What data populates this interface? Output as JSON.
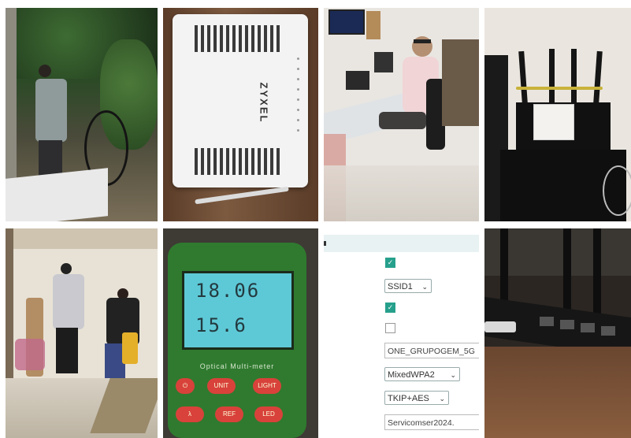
{
  "colors": {
    "background": "#ffffff",
    "checkbox_checked": "#26a08c",
    "meter_screen": "#5ec9d6",
    "meter_buttons": "#d8423a"
  },
  "photos": [
    {
      "icon": "technician-outdoor-photo"
    },
    {
      "icon": "router-photo",
      "brand": "ZYXEL"
    },
    {
      "icon": "technician-desk-photo"
    },
    {
      "icon": "wifi-router-antennas-photo"
    },
    {
      "icon": "installation-room-photo"
    },
    {
      "icon": "optical-meter-photo",
      "reading_top": "18.06",
      "reading_bottom": "15.6",
      "label": "Optical Multi-meter",
      "buttons": [
        "UNIT",
        "LIGHT",
        "λ",
        "REF",
        "LED"
      ]
    },
    {
      "icon": "wifi-settings-screenshot"
    },
    {
      "icon": "router-ports-photo"
    }
  ],
  "wifi_form": {
    "enable_checked": true,
    "ssid_select": "SSID1",
    "broadcast_checked": true,
    "isolation_checked": false,
    "ssid_name": "ONE_GRUPOGEM_5G",
    "auth_mode": "MixedWPA2",
    "encryption": "TKIP+AES",
    "password": "Servicomser2024."
  }
}
